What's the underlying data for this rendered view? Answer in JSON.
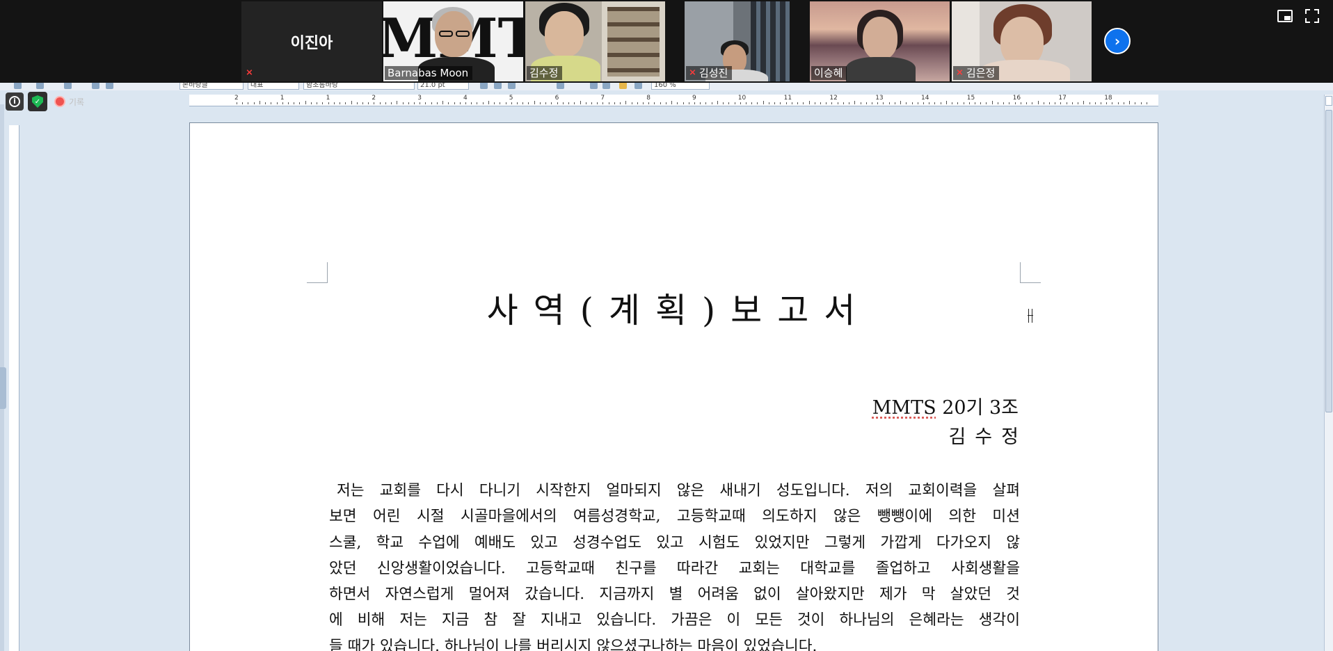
{
  "zoom": {
    "participants": [
      {
        "name": "이진아",
        "muted": true,
        "video": false
      },
      {
        "name": "Barnabas Moon",
        "muted": false,
        "video": true
      },
      {
        "name": "김수정",
        "muted": false,
        "video": true,
        "active_speaker": true
      },
      {
        "name": "김성진",
        "muted": true,
        "video": true
      },
      {
        "name": "이승혜",
        "muted": false,
        "video": true
      },
      {
        "name": "김은정",
        "muted": true,
        "video": true
      }
    ],
    "next_page_icon": "chevron-right-icon",
    "view_icon": "gallery-view-icon",
    "fullscreen_icon": "fullscreen-icon",
    "accent": "#0e72ed",
    "mute_color": "#ff3b3b",
    "active_speaker_color": "#8fd14f"
  },
  "editor": {
    "toolbar": {
      "style": "본바탕글",
      "font_lang": "대표",
      "font": "함초롬바탕",
      "font_size": "21.0 pt",
      "zoom": "160 %"
    },
    "ruler_numbers": [
      "2",
      "1",
      "1",
      "2",
      "3",
      "4",
      "5",
      "6",
      "7",
      "8",
      "9",
      "10",
      "11",
      "12",
      "13",
      "14",
      "15",
      "16",
      "17",
      "18"
    ],
    "status": {
      "info_icon": "info-icon",
      "security_icon": "shield-check-icon",
      "record_label": "기록"
    }
  },
  "document": {
    "title": "사역(계획)보고서",
    "group_en": "MMTS",
    "group_rest": "20기 3조",
    "author": "김수정",
    "body_lines": [
      "저는 교회를 다시 다니기 시작한지 얼마되지 않은 새내기 성도입니다. 저의 교회이력을 살펴",
      "보면 어린 시절 시골마을에서의 여름성경학교, 고등학교때 의도하지 않은 뺑뺑이에 의한 미션",
      "스쿨, 학교 수업에 예배도 있고 성경수업도 있고 시험도 있었지만 그렇게 가깝게 다가오지 않",
      "았던 신앙생활이었습니다. 고등학교때 친구를 따라간 교회는 대학교를 졸업하고 사회생활을",
      "하면서 자연스럽게 멀어져 갔습니다. 지금까지 별 어려움 없이 살아왔지만 제가 막 살았던 것",
      "에 비해 저는 지금 참 잘 지내고 있습니다. 가끔은 이 모든 것이 하나님의 은혜라는 생각이",
      "들 때가 있습니다. 하나님이 나를 버리시지 않으셨구나하는 마음이 있었습니다."
    ]
  }
}
